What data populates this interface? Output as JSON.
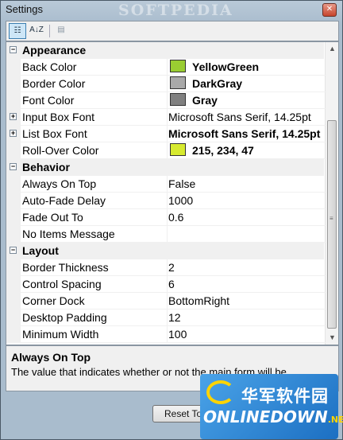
{
  "window": {
    "title": "Settings",
    "watermark": "SOFTPEDIA"
  },
  "toolbar": {
    "categorized": "categorized-view",
    "alphabetical": "A↓Z",
    "pages": "property-pages"
  },
  "grid": {
    "categories": [
      {
        "name": "Appearance",
        "rows": [
          {
            "name": "Back Color",
            "value": "YellowGreen",
            "swatch": "#9acd32",
            "bold": true
          },
          {
            "name": "Border Color",
            "value": "DarkGray",
            "swatch": "#a9a9a9",
            "bold": true
          },
          {
            "name": "Font Color",
            "value": "Gray",
            "swatch": "#808080",
            "bold": true
          },
          {
            "name": "Input Box Font",
            "value": "Microsoft Sans Serif, 14.25pt",
            "expandable": true
          },
          {
            "name": "List Box Font",
            "value": "Microsoft Sans Serif, 14.25pt",
            "expandable": true,
            "bold": true
          },
          {
            "name": "Roll-Over Color",
            "value": "215, 234, 47",
            "swatch": "#d7ea2f",
            "bold": true
          }
        ]
      },
      {
        "name": "Behavior",
        "rows": [
          {
            "name": "Always On Top",
            "value": "False"
          },
          {
            "name": "Auto-Fade Delay",
            "value": "1000"
          },
          {
            "name": "Fade Out To",
            "value": "0.6"
          },
          {
            "name": "No Items Message",
            "value": ""
          }
        ]
      },
      {
        "name": "Layout",
        "rows": [
          {
            "name": "Border Thickness",
            "value": "2"
          },
          {
            "name": "Control Spacing",
            "value": "6"
          },
          {
            "name": "Corner Dock",
            "value": "BottomRight"
          },
          {
            "name": "Desktop Padding",
            "value": "12"
          },
          {
            "name": "Minimum Width",
            "value": "100"
          }
        ]
      }
    ]
  },
  "help": {
    "title": "Always On Top",
    "description": "The value that indicates whether or not the main form will be..."
  },
  "buttons": {
    "reset": "Reset To"
  },
  "logo": {
    "cn": "华军软件园",
    "en": "ONLINEDOWN",
    "net": ".NET"
  }
}
